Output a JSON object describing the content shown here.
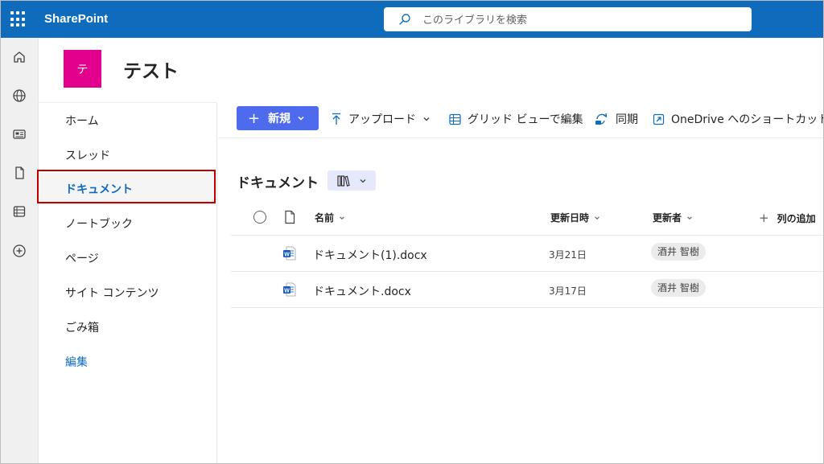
{
  "suitebar": {
    "brand": "SharePoint",
    "search_placeholder": "このライブラリを検索"
  },
  "appbar": {
    "icons": [
      "home-icon",
      "globe-icon",
      "news-icon",
      "document-icon",
      "list-icon",
      "add-circle-icon"
    ]
  },
  "site": {
    "logo_letter": "テ",
    "logo_color": "#e3008c",
    "title": "テスト"
  },
  "nav": {
    "items": [
      {
        "label": "ホーム"
      },
      {
        "label": "スレッド"
      },
      {
        "label": "ドキュメント",
        "selected": true
      },
      {
        "label": "ノートブック"
      },
      {
        "label": "ページ"
      },
      {
        "label": "サイト コンテンツ"
      },
      {
        "label": "ごみ箱"
      }
    ],
    "edit_label": "編集"
  },
  "commands": {
    "new_label": "新規",
    "upload_label": "アップロード",
    "grid_edit_label": "グリッド ビューで編集",
    "sync_label": "同期",
    "shortcut_label": "OneDrive へのショートカットの"
  },
  "library": {
    "title": "ドキュメント",
    "columns": {
      "name": "名前",
      "modified": "更新日時",
      "modified_by": "更新者",
      "add_column": "列の追加"
    },
    "files": [
      {
        "name": "ドキュメント(1).docx",
        "modified": "3月21日",
        "modified_by": "酒井 智樹"
      },
      {
        "name": "ドキュメント.docx",
        "modified": "3月17日",
        "modified_by": "酒井 智樹"
      }
    ]
  },
  "colors": {
    "suitebar": "#0f6cbd",
    "accent": "#4f6bed",
    "highlight_border": "#c00000"
  }
}
